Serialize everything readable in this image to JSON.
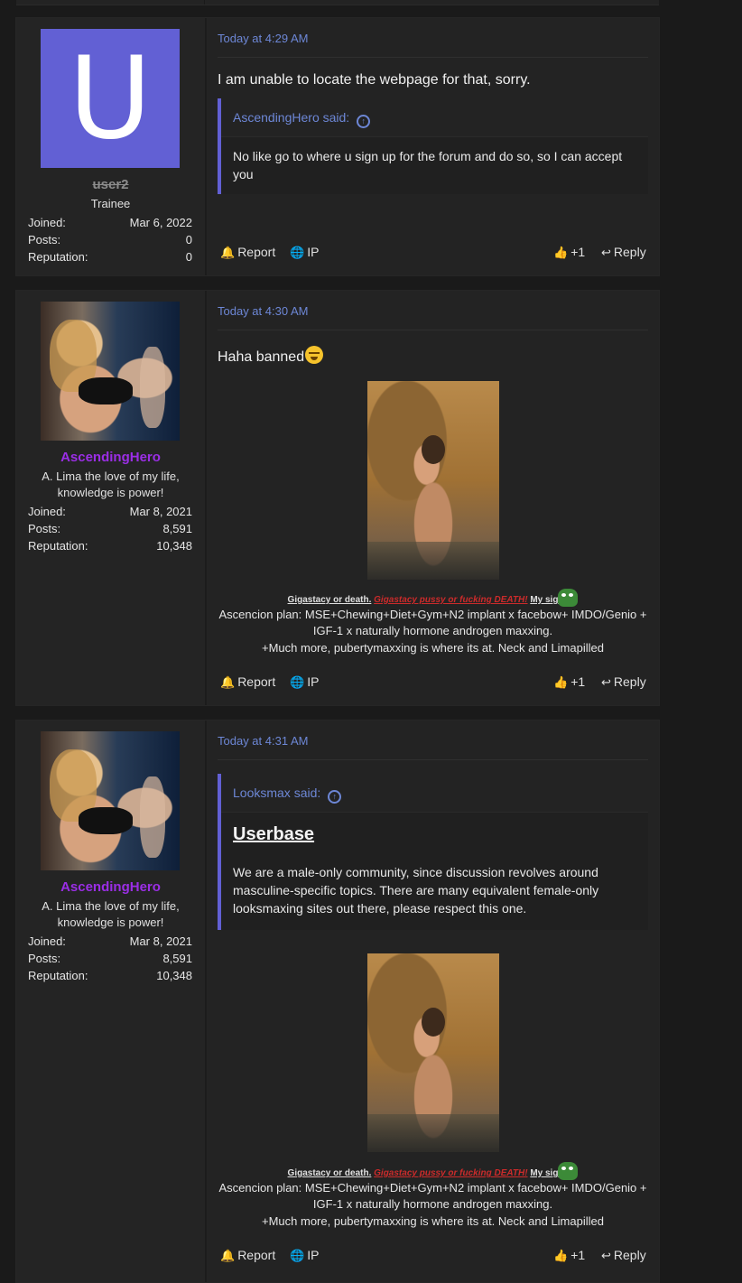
{
  "posts": [
    {
      "user": {
        "avatar_letter": "U",
        "name": "user2",
        "title": "Trainee",
        "stats": [
          {
            "label": "Joined:",
            "value": "Mar 6, 2022"
          },
          {
            "label": "Posts:",
            "value": "0"
          },
          {
            "label": "Reputation:",
            "value": "0"
          }
        ]
      },
      "date": "Today at 4:29 AM",
      "text": "I am unable to locate the webpage for that, sorry.",
      "quote": {
        "author": "AscendingHero said:",
        "body": "No like go to where u sign up for the forum and do so, so I can accept you"
      },
      "actions": {
        "report": "Report",
        "ip": "IP",
        "like": "+1",
        "reply": "Reply"
      }
    },
    {
      "user": {
        "name": "AscendingHero",
        "title": "A. Lima the love of my life, knowledge is power!",
        "stats": [
          {
            "label": "Joined:",
            "value": "Mar 8, 2021"
          },
          {
            "label": "Posts:",
            "value": "8,591"
          },
          {
            "label": "Reputation:",
            "value": "10,348"
          }
        ]
      },
      "date": "Today at 4:30 AM",
      "text": "Haha banned",
      "actions": {
        "report": "Report",
        "ip": "IP",
        "like": "+1",
        "reply": "Reply"
      }
    },
    {
      "user": {
        "name": "AscendingHero",
        "title": "A. Lima the love of my life, knowledge is power!",
        "stats": [
          {
            "label": "Joined:",
            "value": "Mar 8, 2021"
          },
          {
            "label": "Posts:",
            "value": "8,591"
          },
          {
            "label": "Reputation:",
            "value": "10,348"
          }
        ]
      },
      "date": "Today at 4:31 AM",
      "quote": {
        "author": "Looksmax said:",
        "title": "Userbase",
        "body": "We are a male-only community, since discussion revolves around masculine-specific topics. There are many equivalent female-only looksmaxing sites out there, please respect this one."
      },
      "actions": {
        "report": "Report",
        "ip": "IP",
        "like": "+1",
        "reply": "Reply"
      }
    }
  ],
  "signature": {
    "part1": "Gigastacy or death.",
    "part2": "Gigastacy pussy or fucking DEATH!",
    "part3": "My sig",
    "line2": "Ascencion plan: MSE+Chewing+Diet+Gym+N2 implant x facebow+ IMDO/Genio + IGF-1 x naturally hormone androgen maxxing.",
    "line3": "+Much more, pubertymaxxing is where its at. Neck and Limapilled"
  },
  "colors": {
    "accent": "#6260d4",
    "link": "#6d87d6",
    "username_purple": "#9b2ee6",
    "signature_red": "#cc2b2b"
  }
}
